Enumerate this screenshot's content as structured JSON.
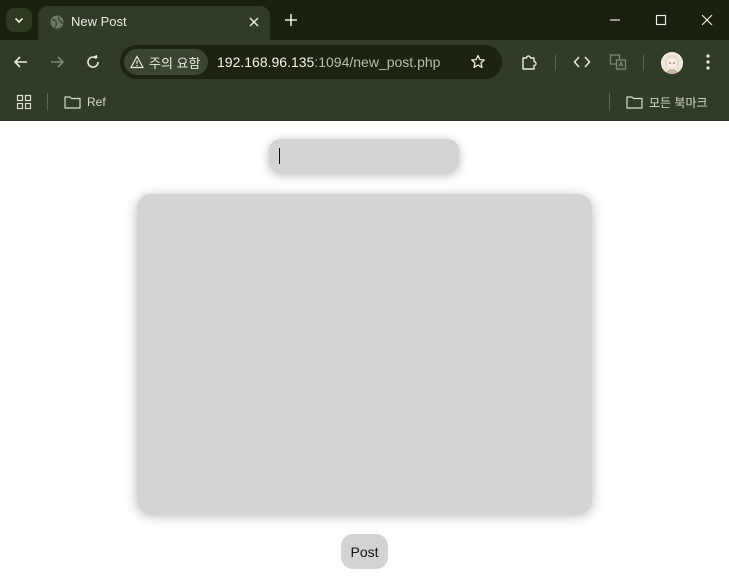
{
  "browser": {
    "tab": {
      "title": "New Post"
    },
    "address": {
      "security_chip": "주의 요함",
      "url_host": "192.168.96.135",
      "url_rest": ":1094/new_post.php"
    },
    "bookmarks": [
      {
        "label": "Ref"
      }
    ],
    "all_bookmarks_label": "모든 북마크",
    "icons": {
      "tab_search": "chevron-down-icon",
      "favicon": "globe-icon",
      "tab_close": "close-icon",
      "new_tab": "plus-icon",
      "minimize": "minimize-icon",
      "maximize": "maximize-icon",
      "close_window": "close-icon",
      "back": "arrow-left-icon",
      "forward": "arrow-right-icon",
      "reload": "reload-icon",
      "warning": "warning-icon",
      "bookmark_star": "star-icon",
      "extensions": "puzzle-icon",
      "devtools": "code-icon",
      "translate": "translate-icon",
      "menu": "kebab-menu-icon",
      "apps": "apps-grid-icon",
      "folder": "folder-icon"
    },
    "colors": {
      "frame_dark": "#1a220f",
      "frame": "#303c25",
      "omnibox": "#1c240f"
    }
  },
  "form": {
    "title_input": {
      "value": "",
      "placeholder": ""
    },
    "content_input": {
      "value": "",
      "placeholder": ""
    },
    "submit_label": "Post",
    "field_color": "#d3d3d3"
  }
}
